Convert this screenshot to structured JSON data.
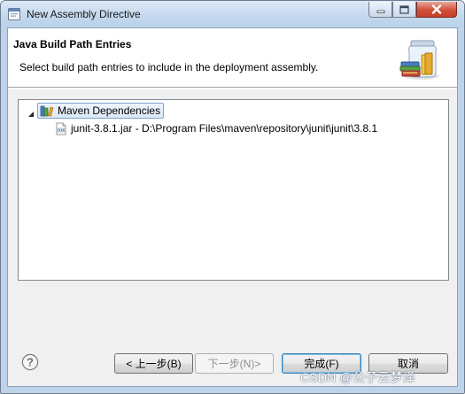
{
  "window": {
    "title": "New Assembly Directive",
    "icon": "eclipse-window-icon"
  },
  "banner": {
    "title": "Java Build Path Entries",
    "description": "Select build path entries to include in the deployment assembly.",
    "icon": "library-jar-icon"
  },
  "tree": {
    "items": [
      {
        "label": "Maven Dependencies",
        "icon": "library-icon",
        "expanded": true,
        "selected": true
      },
      {
        "label": "junit-3.8.1.jar - D:\\Program Files\\maven\\repository\\junit\\junit\\3.8.1",
        "icon": "jar-icon"
      }
    ]
  },
  "buttons": {
    "back": "< 上一步(B)",
    "next": "下一步(N)>",
    "finish": "完成(F)",
    "cancel": "取消",
    "help": "help-icon"
  },
  "watermark": "CSDN @公子云梦泽",
  "colors": {
    "frame": "#bcd3ea",
    "close": "#c7402a",
    "selection": "#dbe8f7"
  }
}
